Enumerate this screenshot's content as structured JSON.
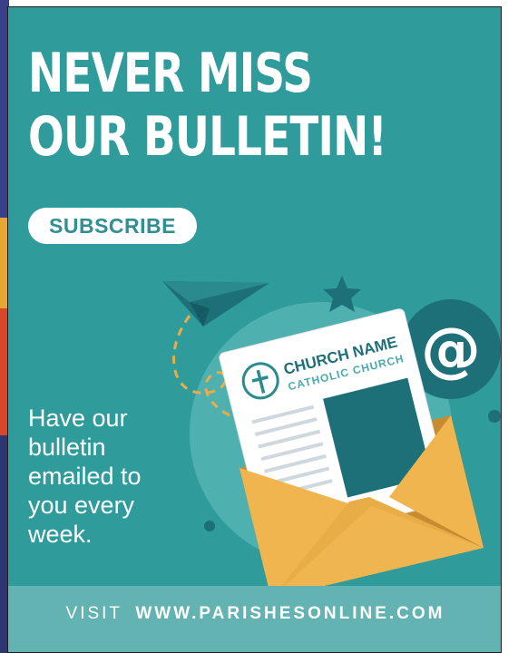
{
  "headline": {
    "line1": "NEVER MISS",
    "line2": "OUR BULLETIN!"
  },
  "subscribe_label": "SUBSCRIBE",
  "body_lines": [
    "Have our",
    "bulletin",
    "emailed to",
    "you every",
    "week."
  ],
  "newsletter": {
    "church_name": "CHURCH NAME",
    "church_type": "CATHOLIC CHURCH"
  },
  "at_symbol": "@",
  "footer": {
    "visit_label": "VISIT",
    "url": "WWW.PARISHESONLINE.COM"
  },
  "icons": [
    "paper-plane-icon",
    "star-icon",
    "cross-icon",
    "at-sign-icon",
    "envelope-icon"
  ],
  "colors": {
    "background": "#2f9b9b",
    "footer": "#62b3b2",
    "envelope": "#e9ad48",
    "dark_teal": "#1d6f78",
    "accent_text": "#2f8f93"
  }
}
